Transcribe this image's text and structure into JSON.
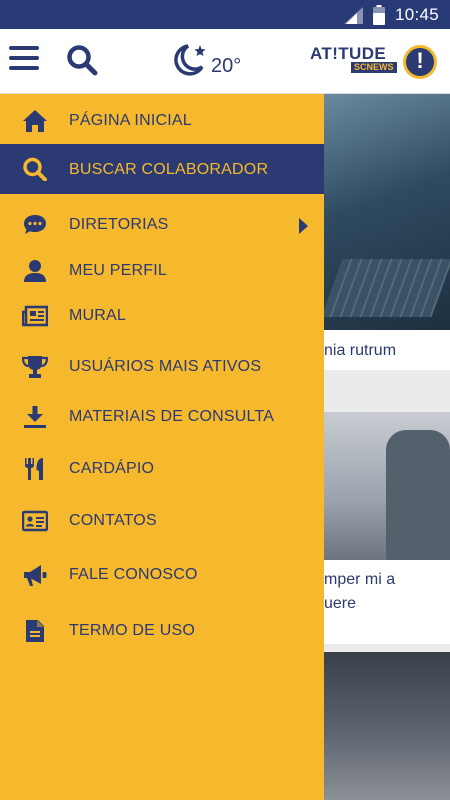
{
  "status_bar": {
    "time": "10:45"
  },
  "app_bar": {
    "temperature": "20°",
    "logo": {
      "brand": "AT!TUDE",
      "sub": "SCNEWS"
    },
    "alert": "!"
  },
  "drawer": {
    "items": [
      {
        "label": "PÁGINA INICIAL",
        "icon": "home-icon"
      },
      {
        "label": "BUSCAR COLABORADOR",
        "icon": "search-icon",
        "active": true
      },
      {
        "label": "DIRETORIAS",
        "icon": "chat-icon",
        "has_submenu": true
      },
      {
        "label": "MEU PERFIL",
        "icon": "person-icon"
      },
      {
        "label": "MURAL",
        "icon": "newspaper-icon"
      },
      {
        "label": "USUÁRIOS MAIS ATIVOS",
        "icon": "trophy-icon"
      },
      {
        "label": "MATERIAIS DE CONSULTA",
        "icon": "download-icon"
      },
      {
        "label": "CARDÁPIO",
        "icon": "cutlery-icon"
      },
      {
        "label": "CONTATOS",
        "icon": "contact-card-icon"
      },
      {
        "label": "FALE CONOSCO",
        "icon": "megaphone-icon"
      },
      {
        "label": "TERMO DE USO",
        "icon": "document-icon"
      }
    ]
  },
  "background_feed": {
    "titles": [
      "nia rutrum",
      "mper mi a",
      "uere"
    ]
  },
  "colors": {
    "primary": "#2b3a72",
    "accent": "#f6b82c"
  }
}
